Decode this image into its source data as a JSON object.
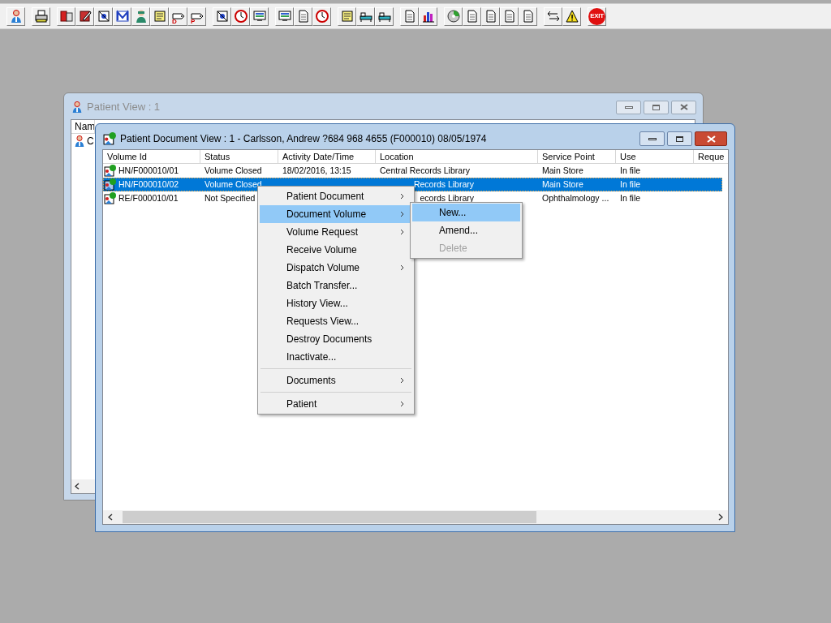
{
  "toolbar": {
    "groups": [
      [
        {
          "kind": "person"
        }
      ],
      [
        {
          "kind": "printer"
        }
      ],
      [
        {
          "kind": "book"
        },
        {
          "kind": "pen"
        },
        {
          "kind": "scan"
        },
        {
          "kind": "envelope"
        },
        {
          "kind": "doctor"
        },
        {
          "kind": "note"
        },
        {
          "kind": "tag",
          "label": "D"
        },
        {
          "kind": "tag",
          "label": "P"
        }
      ],
      [
        {
          "kind": "scan"
        },
        {
          "kind": "clock"
        },
        {
          "kind": "monitor"
        }
      ],
      [
        {
          "kind": "monitor"
        },
        {
          "kind": "document"
        },
        {
          "kind": "clock"
        }
      ],
      [
        {
          "kind": "note"
        },
        {
          "kind": "bed"
        },
        {
          "kind": "bed"
        }
      ],
      [
        {
          "kind": "document"
        },
        {
          "kind": "chart"
        }
      ],
      [
        {
          "kind": "disc"
        },
        {
          "kind": "document"
        },
        {
          "kind": "document"
        },
        {
          "kind": "document"
        },
        {
          "kind": "document"
        }
      ],
      [
        {
          "kind": "arrows"
        },
        {
          "kind": "warning"
        }
      ],
      [
        {
          "kind": "exit",
          "label": "EXIT"
        }
      ]
    ]
  },
  "back_window": {
    "title": "Patient View : 1",
    "columns": [
      "Nam"
    ],
    "rows": [
      "C"
    ]
  },
  "front_window": {
    "title": "Patient Document View : 1 - Carlsson, Andrew ?684 968 4655 (F000010) 08/05/1974",
    "columns": [
      "Volume Id",
      "Status",
      "Activity Date/Time",
      "Location",
      "Service Point",
      "Use",
      "Reque"
    ],
    "rows": [
      {
        "volume_id": "HN/F000010/01",
        "status": "Volume Closed",
        "activity": "18/02/2016, 13:15",
        "location": "Central Records Library",
        "service_point": "Main Store",
        "use": "In file",
        "selected": false
      },
      {
        "volume_id": "HN/F000010/02",
        "status": "Volume Closed",
        "location_tail": "Records Library",
        "service_point": "Main Store",
        "use": "In file",
        "selected": true
      },
      {
        "volume_id": "RE/F000010/01",
        "status": "Not Specified",
        "location_tail": "ecords Library",
        "service_point": "Ophthalmology ...",
        "use": "In file",
        "selected": false
      }
    ]
  },
  "context_menu": {
    "items": [
      {
        "label": "Patient Document",
        "submenu": true,
        "selected": false
      },
      {
        "label": "Document Volume",
        "submenu": true,
        "selected": true
      },
      {
        "label": "Volume Request",
        "submenu": true,
        "selected": false
      },
      {
        "label": "Receive Volume",
        "submenu": false,
        "selected": false
      },
      {
        "label": "Dispatch Volume",
        "submenu": true,
        "selected": false
      },
      {
        "label": "Batch Transfer...",
        "submenu": false,
        "selected": false
      },
      {
        "label": "History View...",
        "submenu": false,
        "selected": false
      },
      {
        "label": "Requests View...",
        "submenu": false,
        "selected": false
      },
      {
        "label": "Destroy Documents",
        "submenu": false,
        "selected": false
      },
      {
        "label": "Inactivate...",
        "submenu": false,
        "selected": false
      },
      {
        "kind": "separator"
      },
      {
        "label": "Documents",
        "submenu": true,
        "selected": false
      },
      {
        "kind": "separator"
      },
      {
        "label": "Patient",
        "submenu": true,
        "selected": false
      }
    ]
  },
  "submenu": {
    "items": [
      {
        "label": "New...",
        "selected": true,
        "disabled": false
      },
      {
        "label": "Amend...",
        "selected": false,
        "disabled": false
      },
      {
        "label": "Delete",
        "selected": false,
        "disabled": true
      }
    ]
  }
}
